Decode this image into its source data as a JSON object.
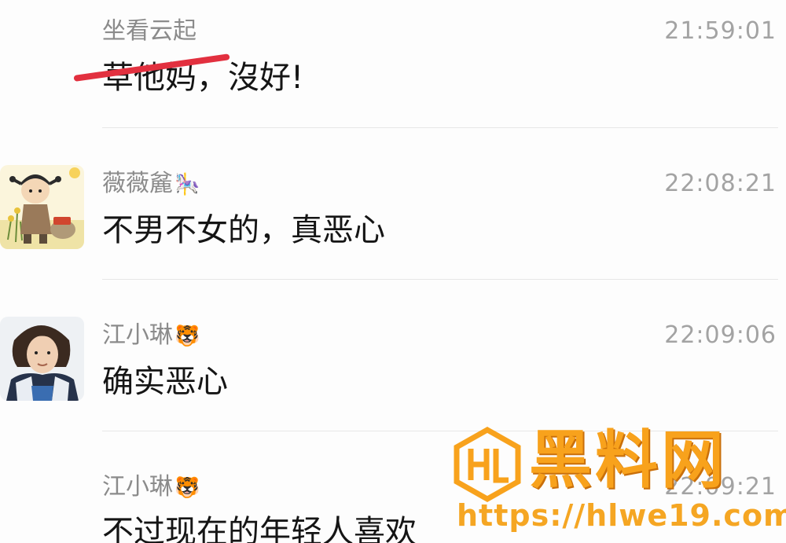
{
  "messages": [
    {
      "sender": "坐看云起",
      "time": "21:59:01",
      "text_struck": "草他妈",
      "text_rest": "，沒好!"
    },
    {
      "sender": "薇薇麄",
      "sender_emoji": "carousel-horse-icon",
      "time": "22:08:21",
      "text": "不男不女的，真恶心"
    },
    {
      "sender": "江小琳",
      "sender_emoji": "tiger-face-icon",
      "time": "22:09:06",
      "text": "确实恶心"
    },
    {
      "sender": "江小琳",
      "sender_emoji": "tiger-face-icon",
      "time": "22:09:21",
      "text": "不过现在的年轻人喜欢"
    }
  ],
  "watermark": {
    "title": "黑料网",
    "url": "https://hlwe19.com"
  },
  "colors": {
    "strike": "#e2303f",
    "watermark": "#f8a21c"
  }
}
